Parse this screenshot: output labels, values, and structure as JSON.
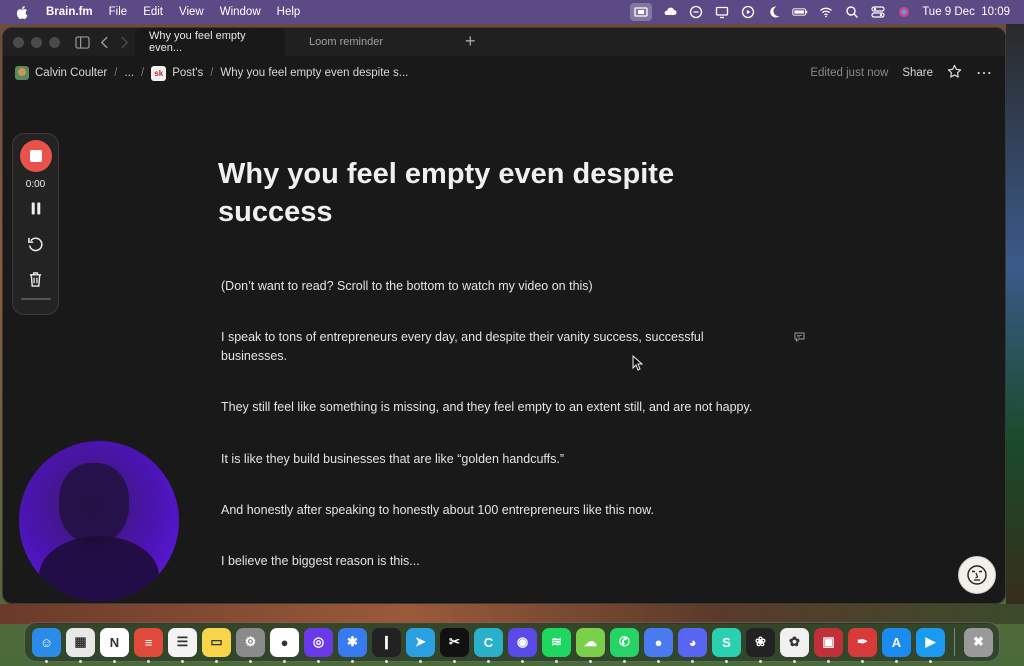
{
  "menubar": {
    "app_name": "Brain.fm",
    "menus": [
      "File",
      "Edit",
      "View",
      "Window",
      "Help"
    ],
    "date_time": "Tue 9 Dec  10:09"
  },
  "browser": {
    "tabs": [
      {
        "label": "Why you feel empty even..."
      },
      {
        "label": "Loom reminder"
      }
    ]
  },
  "breadcrumb": {
    "workspace": "Calvin Coulter",
    "ellipsis": "...",
    "parent_badge": "sk",
    "parent": "Post's",
    "current": "Why you feel empty even despite s..."
  },
  "nav_right": {
    "edited": "Edited just now",
    "share": "Share",
    "more": "⋯"
  },
  "document": {
    "title": "Why you feel empty even despite success",
    "paragraphs": [
      "(Don’t want to read? Scroll to the bottom to watch my video on this)",
      "I speak to tons of entrepreneurs every day, and despite their vanity success, successful businesses.",
      "They still feel like something is missing, and they feel empty to an extent still, and are not happy.",
      "It is like they build businesses that are like “golden handcuffs.”",
      "And honestly after speaking to honestly about 100 entrepreneurs like this now.",
      "I believe the biggest reason is this..."
    ]
  },
  "recorder": {
    "time": "0:00"
  },
  "dock": {
    "apps": [
      "Finder",
      "Launchpad",
      "Notion",
      "Todoist",
      "Reminders",
      "Notes",
      "System Settings",
      "Chrome",
      "Arc",
      "Spike",
      "Voice Memos",
      "Telegram",
      "CapCut",
      "Canva",
      "Loom",
      "Spotify",
      "Messages",
      "WhatsApp",
      "Messenger",
      "Discord",
      "Surfshark",
      "ChatGPT",
      "Photos",
      "Screens",
      "Quill",
      "App Store",
      "Screen Studio",
      "Trash"
    ],
    "colors": [
      "#2a8ce8",
      "#e8e8e8",
      "#ffffff",
      "#e04a3a",
      "#f4f4f4",
      "#f8d44a",
      "#8a8a8a",
      "#ffffff",
      "#6a3ae8",
      "#3a7af0",
      "#222222",
      "#2aa0e0",
      "#111111",
      "#2ab0c8",
      "#5a4ae8",
      "#1ed760",
      "#7ad04a",
      "#25d366",
      "#4a7af0",
      "#5865f2",
      "#2ad0b0",
      "#222222",
      "#f0f0f0",
      "#c0303a",
      "#d83a3a",
      "#1a8cf0",
      "#1a9af0",
      "#9a9a9a"
    ],
    "glyphs": [
      "☺",
      "▦",
      "N",
      "≡",
      "☰",
      "▭",
      "⚙",
      "●",
      "◎",
      "✱",
      "❙",
      "➤",
      "✂",
      "C",
      "◉",
      "≋",
      "☁",
      "✆",
      "●",
      "◕",
      "S",
      "❀",
      "✿",
      "▣",
      "✒",
      "A",
      "▶",
      "✖"
    ]
  }
}
